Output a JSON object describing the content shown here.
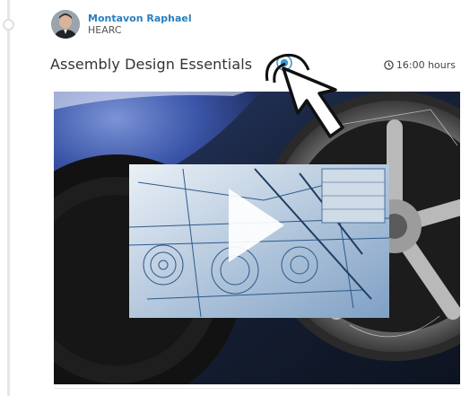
{
  "author": {
    "name": "Montavon Raphael",
    "organization": "HEARC"
  },
  "course": {
    "title": "Assembly Design Essentials",
    "duration": "16:00 hours"
  },
  "icons": {
    "info": "info-icon",
    "clock": "clock-icon",
    "play": "play-icon",
    "cursor": "mouse-pointer-icon"
  },
  "colors": {
    "link": "#2a7fbf",
    "accent": "#3d9ad1"
  }
}
